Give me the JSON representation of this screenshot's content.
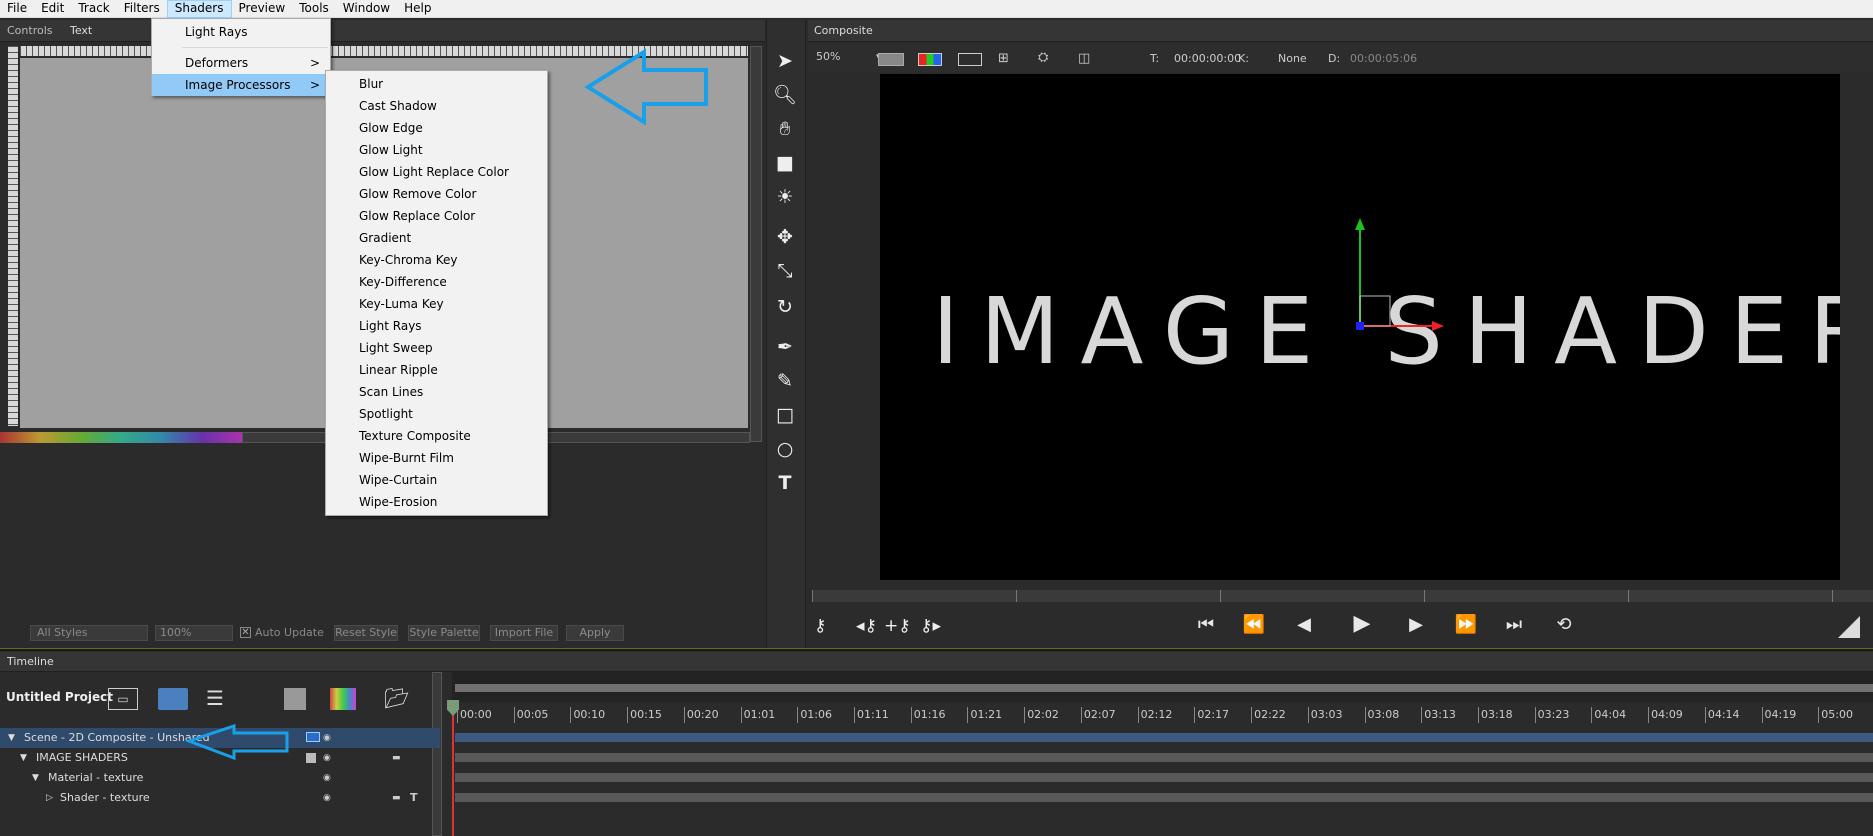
{
  "menubar": {
    "items": [
      "File",
      "Edit",
      "Track",
      "Filters",
      "Shaders",
      "Preview",
      "Tools",
      "Window",
      "Help"
    ],
    "active": "Shaders"
  },
  "shaders_menu": {
    "items": [
      {
        "label": "Light Rays",
        "arrow": ""
      },
      {
        "label": "Deformers",
        "arrow": ">"
      },
      {
        "label": "Image Processors",
        "arrow": ">"
      }
    ]
  },
  "image_processors": {
    "items": [
      "Blur",
      "Cast Shadow",
      "Glow Edge",
      "Glow Light",
      "Glow Light Replace Color",
      "Glow Remove Color",
      "Glow Replace Color",
      "Gradient",
      "Key-Chroma Key",
      "Key-Difference",
      "Key-Luma Key",
      "Light Rays",
      "Light Sweep",
      "Linear Ripple",
      "Scan Lines",
      "Spotlight",
      "Texture Composite",
      "Wipe-Burnt Film",
      "Wipe-Curtain",
      "Wipe-Erosion"
    ]
  },
  "left_panel": {
    "tabs": [
      "Controls",
      "Text"
    ],
    "styles_field": "All Styles",
    "percent_field": "100%",
    "auto_update": "Auto Update",
    "buttons": [
      "Reset Style",
      "Style Palette",
      "Import File",
      "Apply"
    ]
  },
  "composite": {
    "title": "Composite",
    "zoom": "50%",
    "t_label": "T:",
    "t_value": "00:00:00:00",
    "k_label": "K:",
    "k_value": "None",
    "d_label": "D:",
    "d_value": "00:00:05:06",
    "canvas_text": "IMAGE SHADERS"
  },
  "timeline": {
    "title": "Timeline",
    "project": "Untitled Project",
    "rows": [
      "Scene - 2D Composite - Unshared",
      "IMAGE SHADERS",
      "Material - texture",
      "Shader - texture"
    ],
    "ticks": [
      "00:00",
      "00:05",
      "00:10",
      "00:15",
      "00:20",
      "01:01",
      "01:06",
      "01:11",
      "01:16",
      "01:21",
      "02:02",
      "02:07",
      "02:12",
      "02:17",
      "02:22",
      "03:03",
      "03:08",
      "03:13",
      "03:18",
      "03:23",
      "04:04",
      "04:09",
      "04:14",
      "04:19",
      "05:00"
    ]
  },
  "colors": {
    "arrow": "#1aa0e8",
    "menu_highlight": "#91c9f7",
    "panel_bg": "#2b2b2b"
  }
}
